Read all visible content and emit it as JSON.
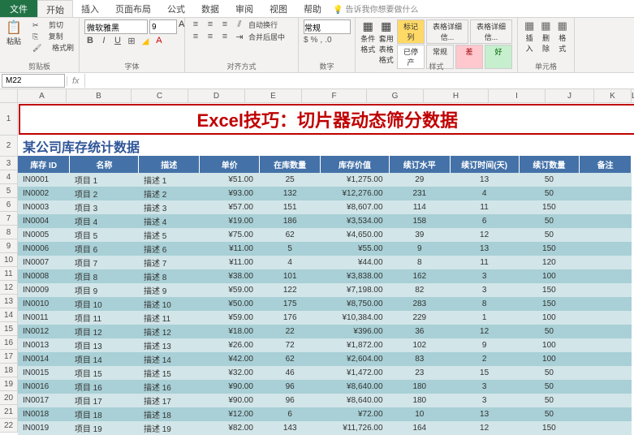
{
  "tabs": {
    "file": "文件",
    "home": "开始",
    "insert": "插入",
    "layout": "页面布局",
    "formula": "公式",
    "data": "数据",
    "review": "审阅",
    "view": "视图",
    "help": "帮助",
    "tellme": "告诉我你想要做什么"
  },
  "ribbon": {
    "clipboard": {
      "paste": "粘贴",
      "cut": "剪切",
      "copy": "复制",
      "brush": "格式刷",
      "label": "剪贴板"
    },
    "font": {
      "name": "微软雅黑",
      "size": "9",
      "label": "字体"
    },
    "align": {
      "wrap": "自动换行",
      "merge": "合并后居中",
      "label": "对齐方式"
    },
    "number": {
      "format": "常规",
      "label": "数字"
    },
    "styles": {
      "cond": "条件格式",
      "table": "套用表格格式",
      "mark": "标记列",
      "stop": "已停产",
      "cell1": "表格详细信...",
      "cell2": "表格详细信...",
      "normal": "常规",
      "bad": "差",
      "good": "好",
      "label": "样式"
    },
    "cells": {
      "insert": "插入",
      "delete": "删除",
      "format": "格式",
      "label": "单元格"
    }
  },
  "namebox": "M22",
  "cols": [
    "A",
    "B",
    "C",
    "D",
    "E",
    "F",
    "G",
    "H",
    "I",
    "J",
    "K",
    "L"
  ],
  "banner": "Excel技巧：切片器动态筛分数据",
  "subtitle": "某公司库存统计数据",
  "headers": [
    "库存 ID",
    "名称",
    "描述",
    "单价",
    "在库数量",
    "库存价值",
    "续订水平",
    "续订时间(天)",
    "续订数量",
    "备注"
  ],
  "chart_data": {
    "type": "table",
    "columns": [
      "库存 ID",
      "名称",
      "描述",
      "单价",
      "在库数量",
      "库存价值",
      "续订水平",
      "续订时间(天)",
      "续订数量",
      "备注"
    ],
    "rows": [
      [
        "IN0001",
        "项目 1",
        "描述 1",
        "¥51.00",
        "25",
        "¥1,275.00",
        "29",
        "13",
        "50",
        ""
      ],
      [
        "IN0002",
        "项目 2",
        "描述 2",
        "¥93.00",
        "132",
        "¥12,276.00",
        "231",
        "4",
        "50",
        ""
      ],
      [
        "IN0003",
        "项目 3",
        "描述 3",
        "¥57.00",
        "151",
        "¥8,607.00",
        "114",
        "11",
        "150",
        ""
      ],
      [
        "IN0004",
        "项目 4",
        "描述 4",
        "¥19.00",
        "186",
        "¥3,534.00",
        "158",
        "6",
        "50",
        ""
      ],
      [
        "IN0005",
        "项目 5",
        "描述 5",
        "¥75.00",
        "62",
        "¥4,650.00",
        "39",
        "12",
        "50",
        ""
      ],
      [
        "IN0006",
        "项目 6",
        "描述 6",
        "¥11.00",
        "5",
        "¥55.00",
        "9",
        "13",
        "150",
        ""
      ],
      [
        "IN0007",
        "项目 7",
        "描述 7",
        "¥11.00",
        "4",
        "¥44.00",
        "8",
        "11",
        "120",
        ""
      ],
      [
        "IN0008",
        "项目 8",
        "描述 8",
        "¥38.00",
        "101",
        "¥3,838.00",
        "162",
        "3",
        "100",
        ""
      ],
      [
        "IN0009",
        "项目 9",
        "描述 9",
        "¥59.00",
        "122",
        "¥7,198.00",
        "82",
        "3",
        "150",
        ""
      ],
      [
        "IN0010",
        "项目 10",
        "描述 10",
        "¥50.00",
        "175",
        "¥8,750.00",
        "283",
        "8",
        "150",
        ""
      ],
      [
        "IN0011",
        "项目 11",
        "描述 11",
        "¥59.00",
        "176",
        "¥10,384.00",
        "229",
        "1",
        "100",
        ""
      ],
      [
        "IN0012",
        "项目 12",
        "描述 12",
        "¥18.00",
        "22",
        "¥396.00",
        "36",
        "12",
        "50",
        ""
      ],
      [
        "IN0013",
        "项目 13",
        "描述 13",
        "¥26.00",
        "72",
        "¥1,872.00",
        "102",
        "9",
        "100",
        ""
      ],
      [
        "IN0014",
        "项目 14",
        "描述 14",
        "¥42.00",
        "62",
        "¥2,604.00",
        "83",
        "2",
        "100",
        ""
      ],
      [
        "IN0015",
        "项目 15",
        "描述 15",
        "¥32.00",
        "46",
        "¥1,472.00",
        "23",
        "15",
        "50",
        ""
      ],
      [
        "IN0016",
        "项目 16",
        "描述 16",
        "¥90.00",
        "96",
        "¥8,640.00",
        "180",
        "3",
        "50",
        ""
      ],
      [
        "IN0017",
        "项目 17",
        "描述 17",
        "¥90.00",
        "96",
        "¥8,640.00",
        "180",
        "3",
        "50",
        ""
      ],
      [
        "IN0018",
        "项目 18",
        "描述 18",
        "¥12.00",
        "6",
        "¥72.00",
        "10",
        "13",
        "50",
        ""
      ],
      [
        "IN0019",
        "项目 19",
        "描述 19",
        "¥82.00",
        "143",
        "¥11,726.00",
        "164",
        "12",
        "150",
        ""
      ]
    ]
  }
}
